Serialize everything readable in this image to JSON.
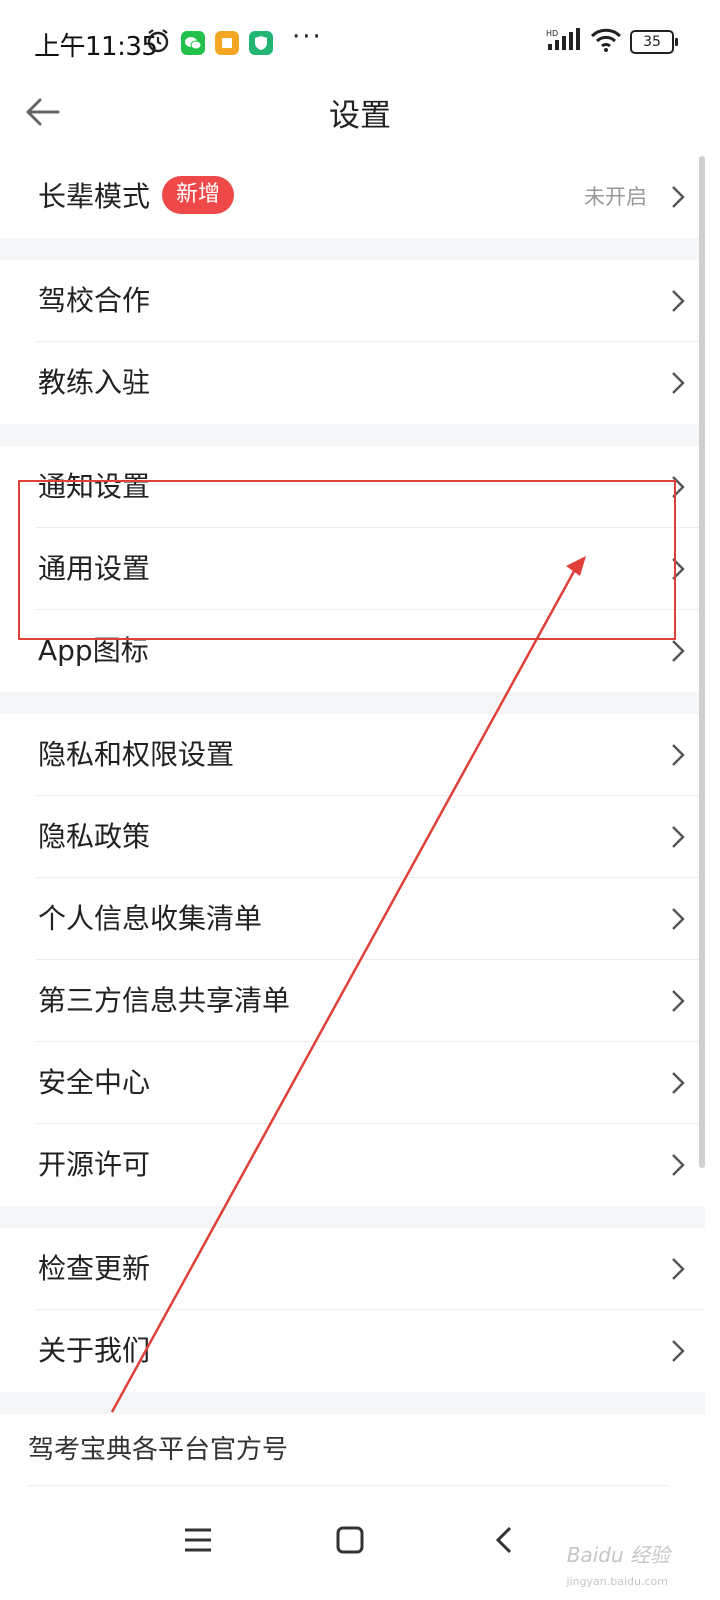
{
  "status_bar": {
    "time": "上午11:35",
    "signal": "HD",
    "battery": "35"
  },
  "header": {
    "title": "设置"
  },
  "elder_mode": {
    "label": "长辈模式",
    "badge": "新增",
    "value": "未开启"
  },
  "group1": [
    {
      "label": "驾校合作"
    },
    {
      "label": "教练入驻"
    }
  ],
  "group2": [
    {
      "label": "通知设置"
    },
    {
      "label": "通用设置"
    },
    {
      "label": "App图标"
    }
  ],
  "group3": [
    {
      "label": "隐私和权限设置"
    },
    {
      "label": "隐私政策"
    },
    {
      "label": "个人信息收集清单"
    },
    {
      "label": "第三方信息共享清单"
    },
    {
      "label": "安全中心"
    },
    {
      "label": "开源许可"
    }
  ],
  "group4": [
    {
      "label": "检查更新"
    },
    {
      "label": "关于我们"
    }
  ],
  "footer": {
    "label": "驾考宝典各平台官方号"
  },
  "watermark": {
    "text": "Baidu 经验",
    "sub": "jingyan.baidu.com"
  },
  "colors": {
    "badge": "#ee4848",
    "annotation": "#e0403a"
  }
}
